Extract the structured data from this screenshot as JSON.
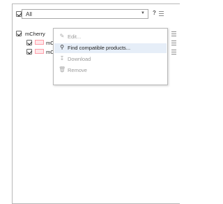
{
  "filter": {
    "checked": true,
    "selected_value": "All",
    "help_label": "?"
  },
  "tree": {
    "root": {
      "label": "mCherry",
      "checked": true
    },
    "children": [
      {
        "label": "mChe",
        "checked": true,
        "swatch_color": "#ff9da8"
      },
      {
        "label": "mChe",
        "checked": true,
        "swatch_color": "#ff9da8"
      }
    ]
  },
  "context_menu": {
    "items": [
      {
        "label": "Edit...",
        "icon": "pencil-icon",
        "enabled": false
      },
      {
        "label": "Find compatible products...",
        "icon": "search-icon",
        "enabled": true,
        "highlighted": true
      },
      {
        "label": "Download",
        "icon": "download-icon",
        "enabled": false
      },
      {
        "label": "Remove",
        "icon": "trash-icon",
        "enabled": false
      }
    ]
  },
  "colors": {
    "highlight": "#e6eef8",
    "border": "#b8b8b8",
    "disabled_text": "#9a9a9a"
  }
}
